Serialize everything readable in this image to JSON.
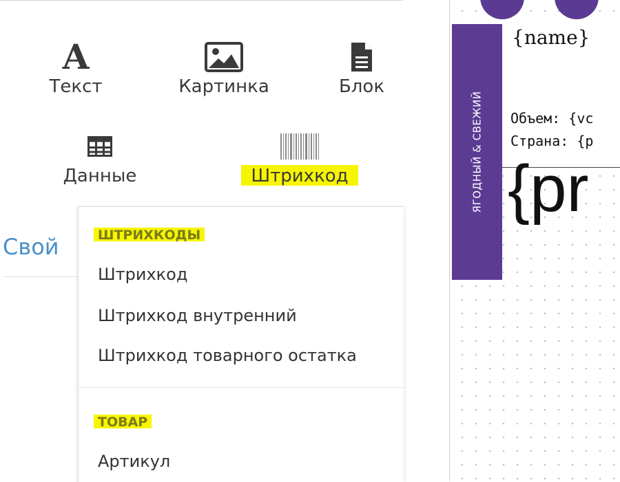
{
  "toolbox": {
    "items": [
      {
        "id": "text",
        "label": "Текст",
        "icon": "text-icon"
      },
      {
        "id": "image",
        "label": "Картинка",
        "icon": "image-icon"
      },
      {
        "id": "block",
        "label": "Блок",
        "icon": "document-icon"
      },
      {
        "id": "data",
        "label": "Данные",
        "icon": "table-icon"
      },
      {
        "id": "barcode",
        "label": "Штрихкод",
        "icon": "barcode-icon"
      }
    ]
  },
  "section": {
    "title": "Свой"
  },
  "dropdown": {
    "groups": [
      {
        "header": "ШТРИХКОДЫ",
        "items": [
          "Штрихкод",
          "Штрихкод внутренний",
          "Штрихкод товарного остатка"
        ]
      },
      {
        "header": "ТОВАР",
        "items": [
          "Артикул"
        ]
      }
    ]
  },
  "canvas": {
    "strip_text": "ЯГОДНЫЙ & СВЕЖИЙ",
    "name_field": "{name}",
    "volume_line": "Объем: {vc",
    "country_line": "Страна: {p",
    "big_field": "{pr"
  },
  "colors": {
    "accent_purple": "#5c3b93",
    "highlight_yellow": "#f7f500",
    "section_blue": "#4a90c8"
  }
}
